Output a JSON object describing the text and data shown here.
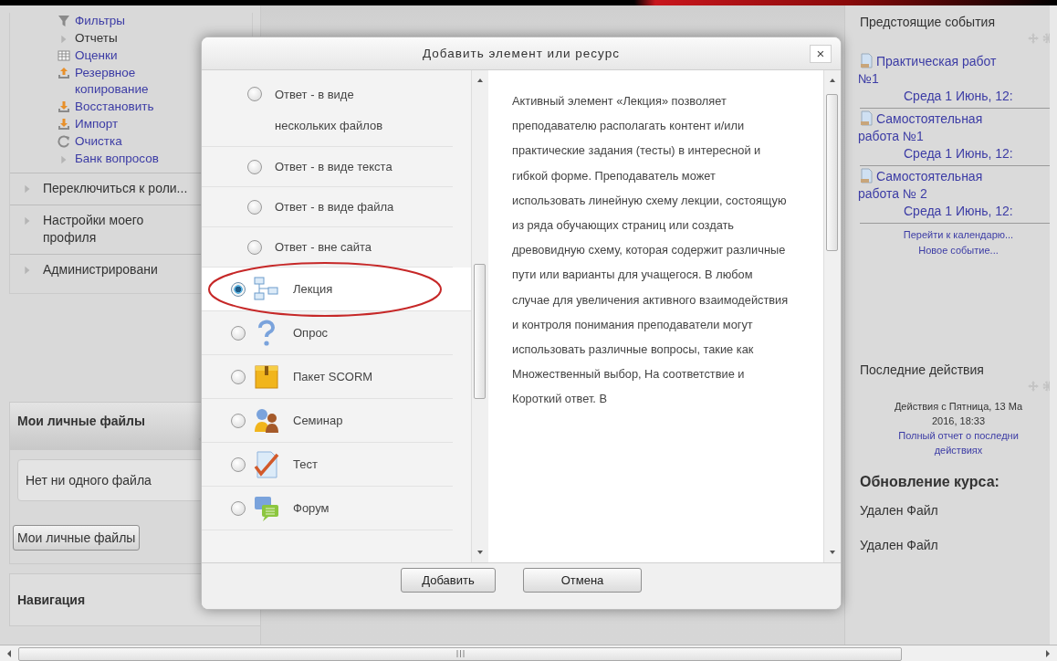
{
  "left_nav": {
    "items": [
      {
        "label": "Фильтры",
        "link": true
      },
      {
        "label": "Отчеты",
        "link": false
      },
      {
        "label": "Оценки",
        "link": true
      },
      {
        "label": "Резервное копирование",
        "link": true
      },
      {
        "label": "Восстановить",
        "link": true
      },
      {
        "label": "Импорт",
        "link": true
      },
      {
        "label": "Очистка",
        "link": true
      },
      {
        "label": "Банк вопросов",
        "link": true
      }
    ],
    "sections": [
      "Переключиться к роли...",
      "Настройки моего профиля",
      "Администрировани"
    ]
  },
  "private_files": {
    "title": "Мои личные файлы",
    "empty": "Нет ни одного файла",
    "button": "Мои личные файлы"
  },
  "navigation": {
    "title": "Навигация"
  },
  "dialog": {
    "title": "Добавить элемент или ресурс",
    "close": "×",
    "items": [
      {
        "kind": "option",
        "label": "Ответ - в виде нескольких файлов",
        "selected": false
      },
      {
        "kind": "option",
        "label": "Ответ - в виде текста",
        "selected": false
      },
      {
        "kind": "option",
        "label": "Ответ - в виде файла",
        "selected": false
      },
      {
        "kind": "option",
        "label": "Ответ - вне сайта",
        "selected": false
      },
      {
        "kind": "module",
        "label": "Лекция",
        "selected": true
      },
      {
        "kind": "module",
        "label": "Опрос",
        "selected": false
      },
      {
        "kind": "module",
        "label": "Пакет SCORM",
        "selected": false
      },
      {
        "kind": "module",
        "label": "Семинар",
        "selected": false
      },
      {
        "kind": "module",
        "label": "Тест",
        "selected": false
      },
      {
        "kind": "module",
        "label": "Форум",
        "selected": false
      }
    ],
    "description": "Активный элемент «Лекция» позволяет преподавателю располагать контент и/или практические задания (тесты) в интересной и гибкой форме. Преподаватель может использовать линейную схему лекции, состоящую из ряда обучающих страниц или создать древовидную схему, которая содержит различные пути или варианты для учащегося. В любом случае для увеличения активного взаимодействия и контроля понимания преподаватели могут использовать различные вопросы, такие как Множественный выбор, На соответствие и Короткий ответ. В",
    "buttons": [
      "Добавить",
      "Отмена"
    ]
  },
  "upcoming": {
    "title": "Предстоящие события",
    "events": [
      {
        "title": "Практическая работ",
        "suffix": "№1",
        "date": "Среда 1 Июнь, 12:"
      },
      {
        "title": "Самостоятельная",
        "suffix": "работа №1",
        "date": "Среда 1 Июнь, 12:"
      },
      {
        "title": "Самостоятельная",
        "suffix": "работа № 2",
        "date": "Среда 1 Июнь, 12:"
      }
    ],
    "links": [
      "Перейти к календарю...",
      "Новое событие..."
    ]
  },
  "recent": {
    "title": "Последние действия",
    "since": [
      "Действия с Пятница, 13 Ма",
      "2016, 18:33"
    ],
    "report": [
      "Полный отчет о последни",
      "действиях"
    ],
    "updates_title": "Обновление курса:",
    "updates": [
      "Удален Файл",
      "Удален Файл"
    ]
  }
}
